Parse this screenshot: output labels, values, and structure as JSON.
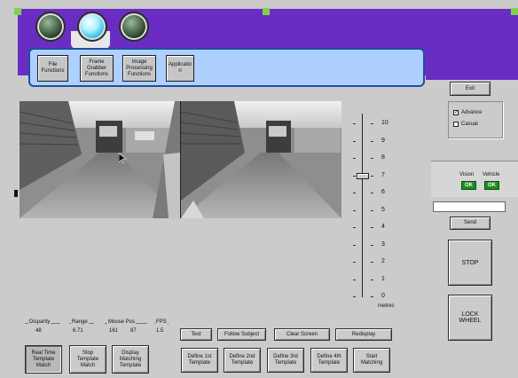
{
  "menu": {
    "items": [
      {
        "label": "File\nFunctions"
      },
      {
        "label": "Frame\nGrabber\nFunctions"
      },
      {
        "label": "Image\nProcessing\nFunctions"
      },
      {
        "label": "Applicatio\nn"
      }
    ]
  },
  "sidebar": {
    "exit_label": "Exit",
    "advance_label": "Advance",
    "advance_checked": true,
    "casual_label": "Casual",
    "casual_checked": false,
    "vision_label": "Vision",
    "vehicle_label": "Vehicle",
    "vision_status": "OK",
    "vehicle_status": "OK",
    "send_label": "Send",
    "send_input_value": "",
    "stop_label": "STOP",
    "lock_wheel_label": "LOCK\nWHEEL"
  },
  "scale": {
    "ticks": [
      "10",
      "9",
      "8",
      "7",
      "6",
      "5",
      "4",
      "3",
      "2",
      "1",
      "0"
    ],
    "unit_label": "metres",
    "slider_value": 7
  },
  "readouts": {
    "disparity_label": "Disparity",
    "disparity_value": "48",
    "range_label": "Range",
    "range_value": "6.71",
    "mouse_pos_label": "Mouse Pos",
    "mouse_x": "161",
    "mouse_y": "87",
    "fps_label": "FPS",
    "fps_value": "1.5"
  },
  "toolbar": {
    "test_label": "Test",
    "follow_subject_label": "Follow Subject",
    "clear_screen_label": "Clear Screen",
    "redisplay_label": "Redisplay"
  },
  "bottom_buttons": {
    "real_time_label": "Real Time\nTemplate\nMatch",
    "stop_template_label": "Stop\nTemplate\nMatch",
    "display_matching_label": "Display\nMatching\nTemplate",
    "define1_label": "Define 1st\nTemplate",
    "define2_label": "Define 2nd\nTemplate",
    "define3_label": "Define 3rd\nTemplate",
    "define4_label": "Define 4th\nTemplate",
    "start_matching_label": "Start\nMatching"
  },
  "colors": {
    "title_bar": "#6a2dc4",
    "menu_panel": "#aed0ff",
    "window_bg": "#cbcbcb",
    "ok_badge": "#1f8d1f"
  },
  "icons": [
    "status-led-icon",
    "cursor-arrow-icon",
    "checkbox-icon"
  ]
}
